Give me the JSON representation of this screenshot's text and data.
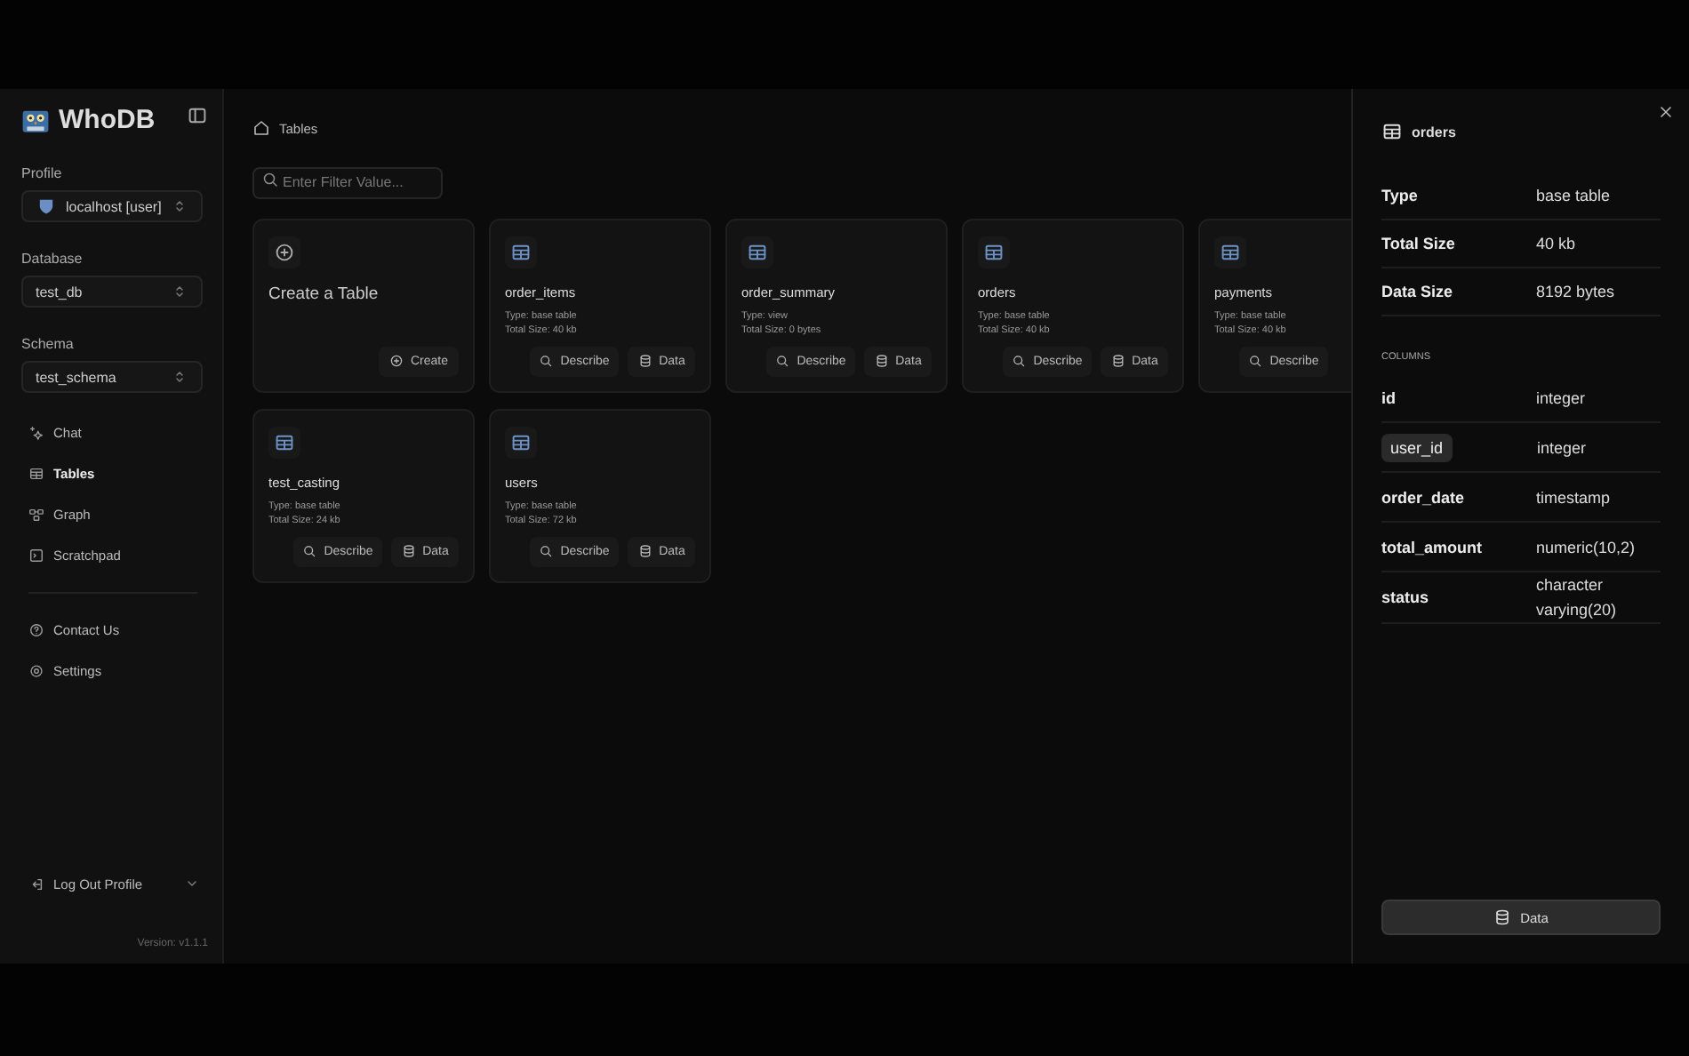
{
  "app": {
    "name": "WhoDB"
  },
  "sidebar": {
    "selects": [
      {
        "label": "Profile",
        "value": "localhost [user]",
        "kind": "profile"
      },
      {
        "label": "Database",
        "value": "test_db",
        "kind": "plain"
      },
      {
        "label": "Schema",
        "value": "test_schema",
        "kind": "plain"
      }
    ],
    "nav": [
      {
        "label": "Chat",
        "selected": false
      },
      {
        "label": "Tables",
        "selected": true
      },
      {
        "label": "Graph",
        "selected": false
      },
      {
        "label": "Scratchpad",
        "selected": false
      }
    ],
    "footer_nav": [
      {
        "label": "Contact Us"
      },
      {
        "label": "Settings"
      }
    ],
    "logout": "Log Out Profile",
    "version": "Version: v1.1.1"
  },
  "breadcrumb": "Tables",
  "filter": {
    "placeholder": "Enter Filter Value..."
  },
  "create_card": {
    "title": "Create a Table",
    "button": "Create"
  },
  "tables": [
    {
      "name": "order_items",
      "type": "Type: base table",
      "size": "Total Size: 40 kb",
      "buttons": [
        "Describe",
        "Data"
      ]
    },
    {
      "name": "order_summary",
      "type": "Type: view",
      "size": "Total Size: 0 bytes",
      "buttons": [
        "Describe",
        "Data"
      ]
    },
    {
      "name": "orders",
      "type": "Type: base table",
      "size": "Total Size: 40 kb",
      "buttons": [
        "Describe",
        "Data"
      ]
    },
    {
      "name": "payments",
      "type": "Type: base table",
      "size": "Total Size: 40 kb",
      "buttons": [
        "Describe"
      ]
    },
    {
      "name": "test_casting",
      "type": "Type: base table",
      "size": "Total Size: 24 kb",
      "buttons": [
        "Describe",
        "Data"
      ]
    },
    {
      "name": "users",
      "type": "Type: base table",
      "size": "Total Size: 72 kb",
      "buttons": [
        "Describe",
        "Data"
      ]
    }
  ],
  "panel": {
    "title": "orders",
    "properties": [
      {
        "key": "Type",
        "value": "base table"
      },
      {
        "key": "Total Size",
        "value": "40 kb"
      },
      {
        "key": "Data Size",
        "value": "8192 bytes"
      }
    ],
    "columns_heading": "COLUMNS",
    "columns": [
      {
        "name": "id",
        "type": "integer",
        "selected": false
      },
      {
        "name": "user_id",
        "type": "integer",
        "selected": true
      },
      {
        "name": "order_date",
        "type": "timestamp",
        "selected": false
      },
      {
        "name": "total_amount",
        "type": "numeric(10,2)",
        "selected": false
      },
      {
        "name": "status",
        "type": "character varying(20)",
        "selected": false
      }
    ],
    "button": "Data"
  }
}
